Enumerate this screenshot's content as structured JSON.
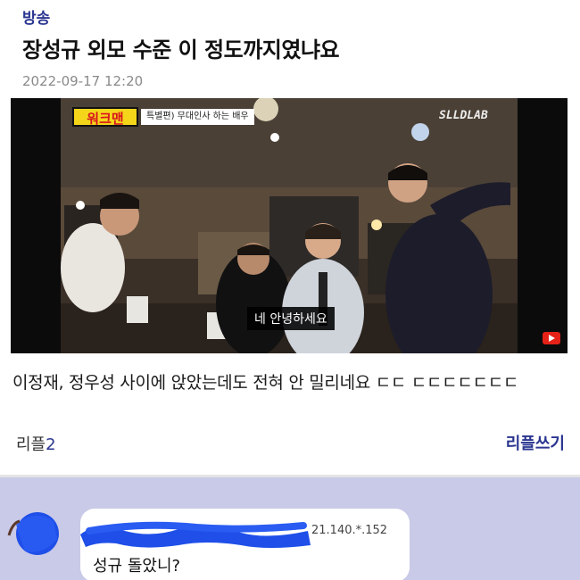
{
  "post": {
    "category": "방송",
    "title": "장성규 외모 수준 이 정도까지였냐요",
    "date": "2022-09-17 12:20",
    "body": "이정재, 정우성 사이에 앉았는데도 전혀 안 밀리네요 ㄷㄷ ㄷㄷㄷㄷㄷㄷㄷ",
    "reply_label": "리플",
    "reply_count": "2",
    "write_reply_label": "리플쓰기"
  },
  "video": {
    "show_logo": "워크맨",
    "episode_tag": "특별편) 무대인사 하는 배우",
    "channel_watermark": "SLLDLAB",
    "subtitle": "네 안녕하세요"
  },
  "comment": {
    "ip": "21.140.*.152",
    "text": "성규 돌았니?"
  },
  "colors": {
    "brand": "#2a3590",
    "chat_background": "#c9c9e8",
    "redaction": "#1f4fe8"
  }
}
